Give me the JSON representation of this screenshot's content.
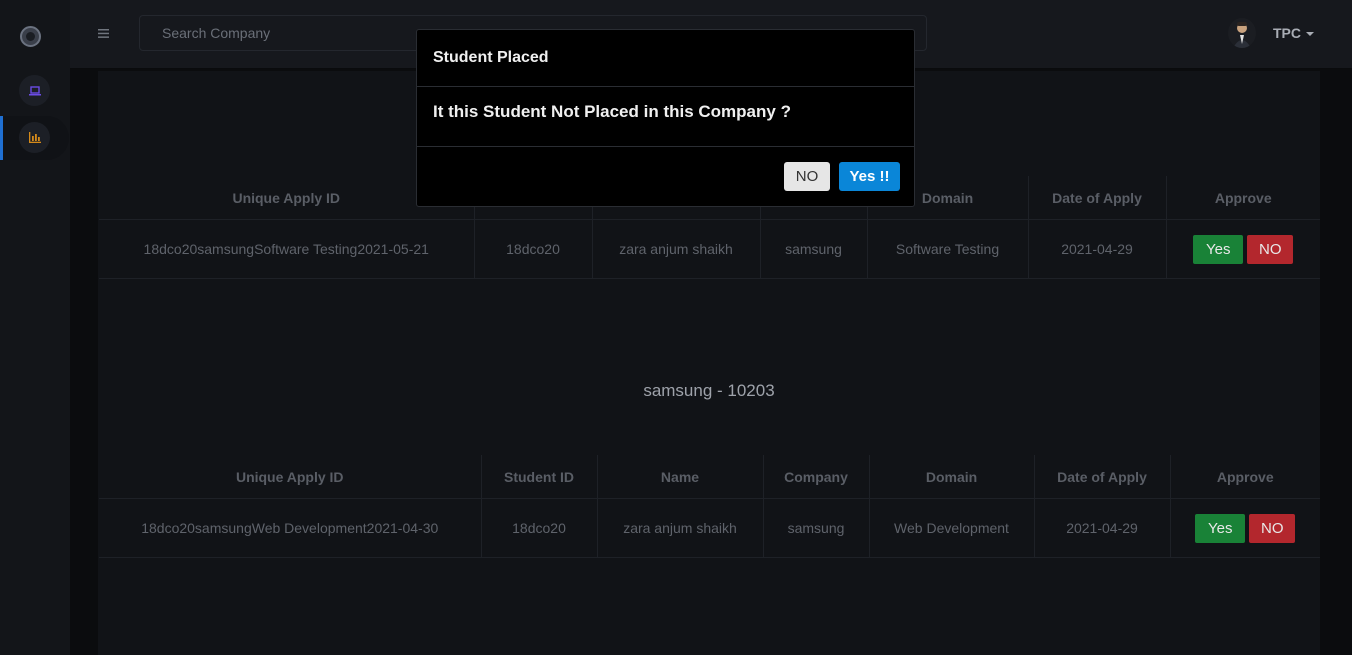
{
  "topbar": {
    "search_placeholder": "Search Company",
    "user_label": "TPC"
  },
  "sidebar": {
    "items": [
      {
        "icon": "laptop-icon",
        "color": "#6b4ce6"
      },
      {
        "icon": "bar-chart-icon",
        "color": "#d48a1a"
      }
    ]
  },
  "tables": {
    "headers": [
      "Unique Apply ID",
      "Student ID",
      "Name",
      "Company",
      "Domain",
      "Date of Apply",
      "Approve"
    ],
    "first": {
      "row": [
        "18dco20samsungSoftware Testing2021-05-21",
        "18dco20",
        "zara anjum shaikh",
        "samsung",
        "Software Testing",
        "2021-04-29"
      ],
      "yes": "Yes",
      "no": "NO"
    },
    "second_title": "samsung - 10203",
    "second": {
      "row": [
        "18dco20samsungWeb Development2021-04-30",
        "18dco20",
        "zara anjum shaikh",
        "samsung",
        "Web Development",
        "2021-04-29"
      ],
      "yes": "Yes",
      "no": "NO"
    }
  },
  "modal": {
    "title": "Student Placed",
    "body": "It this Student Not Placed in this Company ?",
    "no_label": "NO",
    "yes_label": "Yes !!"
  },
  "colors": {
    "yes": "#198237",
    "no": "#b3272d",
    "modal_yes": "#0a86d8",
    "active_bar": "#1f6fd1"
  }
}
